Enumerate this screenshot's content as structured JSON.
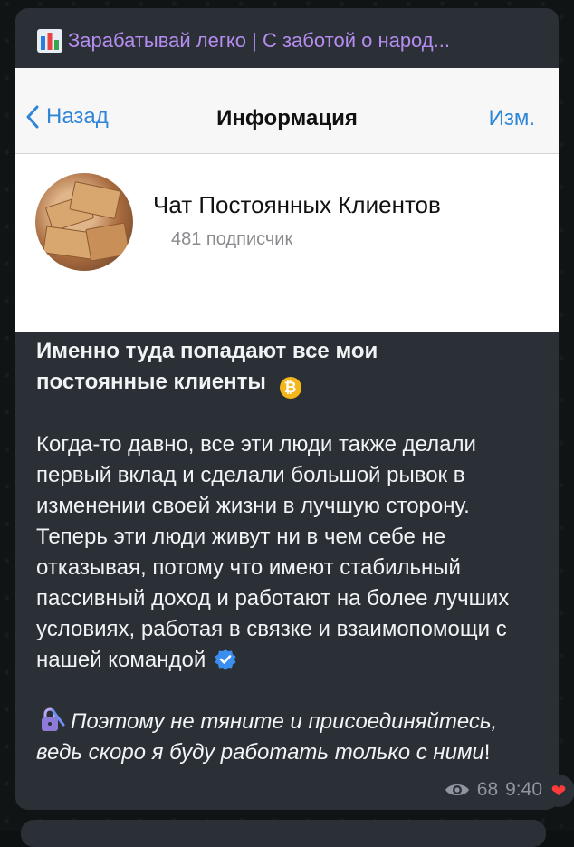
{
  "channel": {
    "title": "Зарабатывай легко | С заботой о народ..."
  },
  "screenshot": {
    "back_label": "Назад",
    "nav_title": "Информация",
    "edit_label": "Изм.",
    "chat_name": "Чат Постоянных Клиентов",
    "subscribers": "481 подписчик"
  },
  "message": {
    "heading_line1": "Именно туда попадают все мои",
    "heading_line2": "постоянные клиенты",
    "heading_emoji": "₿",
    "body": "Когда-то давно, все эти люди также делали первый вклад и сделали большой рывок в изменении своей жизни в лучшую сторону. Теперь эти люди живут ни в чем себе не отказывая, потому что имеют стабильный пассивный доход и работают на более лучших условиях, работая в связке и взаимопомощи с нашей командой",
    "cta_italic": "Поэтому не тяните и присоединяйтесь, ведь скоро я буду работать только с ними",
    "cta_end": "!"
  },
  "meta": {
    "views": "68",
    "time": "9:40"
  },
  "reaction": {
    "emoji": "❤"
  },
  "icons": {
    "title_icon": "bar-chart-icon",
    "heading_icon": "bitcoin-icon",
    "body_icon": "verified-icon",
    "cta_icon": "lock-icon",
    "views_icon": "eye-icon"
  },
  "colors": {
    "title": "#b58cf0",
    "link": "#2f86d6",
    "bubble": "#2b3036",
    "meta": "#8f96a0"
  }
}
